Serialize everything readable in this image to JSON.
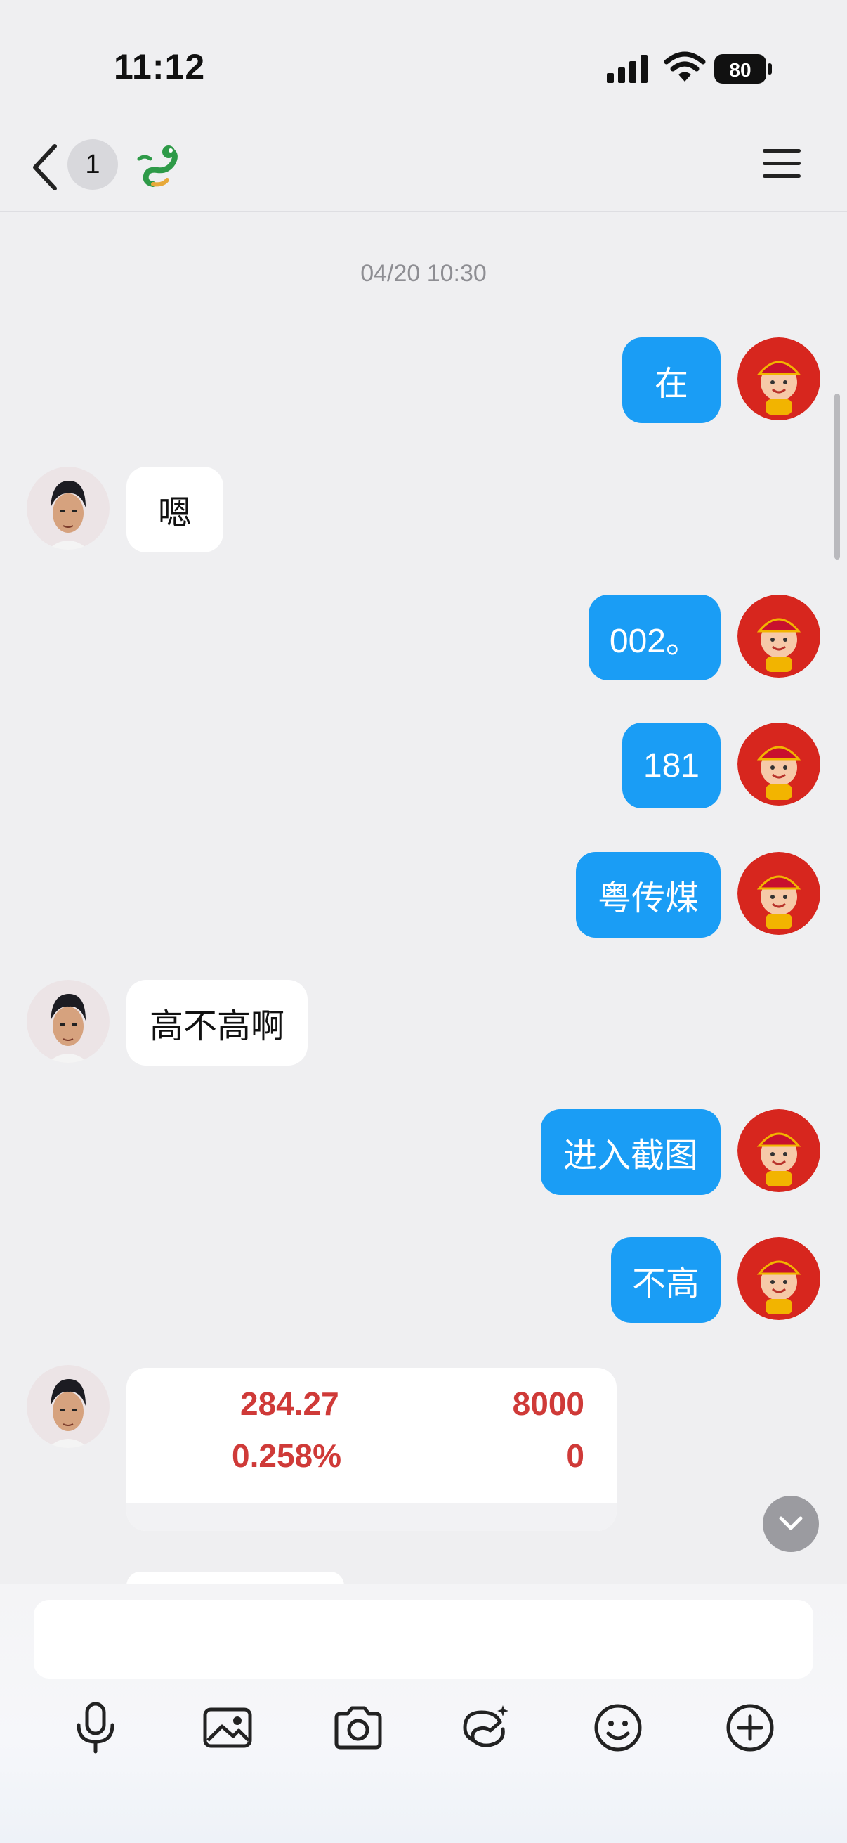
{
  "status_bar": {
    "time": "11:12",
    "battery": "80"
  },
  "header": {
    "unread_count": "1"
  },
  "chat": {
    "timestamp": "04/20 10:30",
    "messages": [
      {
        "from": "self",
        "text": "在"
      },
      {
        "from": "other",
        "text": "嗯"
      },
      {
        "from": "self",
        "text": "002。"
      },
      {
        "from": "self",
        "text": "181"
      },
      {
        "from": "self",
        "text": "粤传煤"
      },
      {
        "from": "other",
        "text": "高不高啊"
      },
      {
        "from": "self",
        "text": "进入截图"
      },
      {
        "from": "self",
        "text": "不高"
      }
    ],
    "stock_card": {
      "price": "284.27",
      "volume": "8000",
      "percent": "0.258%",
      "value": "0"
    }
  },
  "input": {
    "placeholder": ""
  },
  "toolbar": [
    "microphone-icon",
    "image-icon",
    "camera-icon",
    "sticker-icon",
    "emoji-icon",
    "plus-icon"
  ],
  "colors": {
    "self_bubble": "#1a9df5",
    "background": "#efeff1",
    "stock_red": "#cf3a38"
  }
}
